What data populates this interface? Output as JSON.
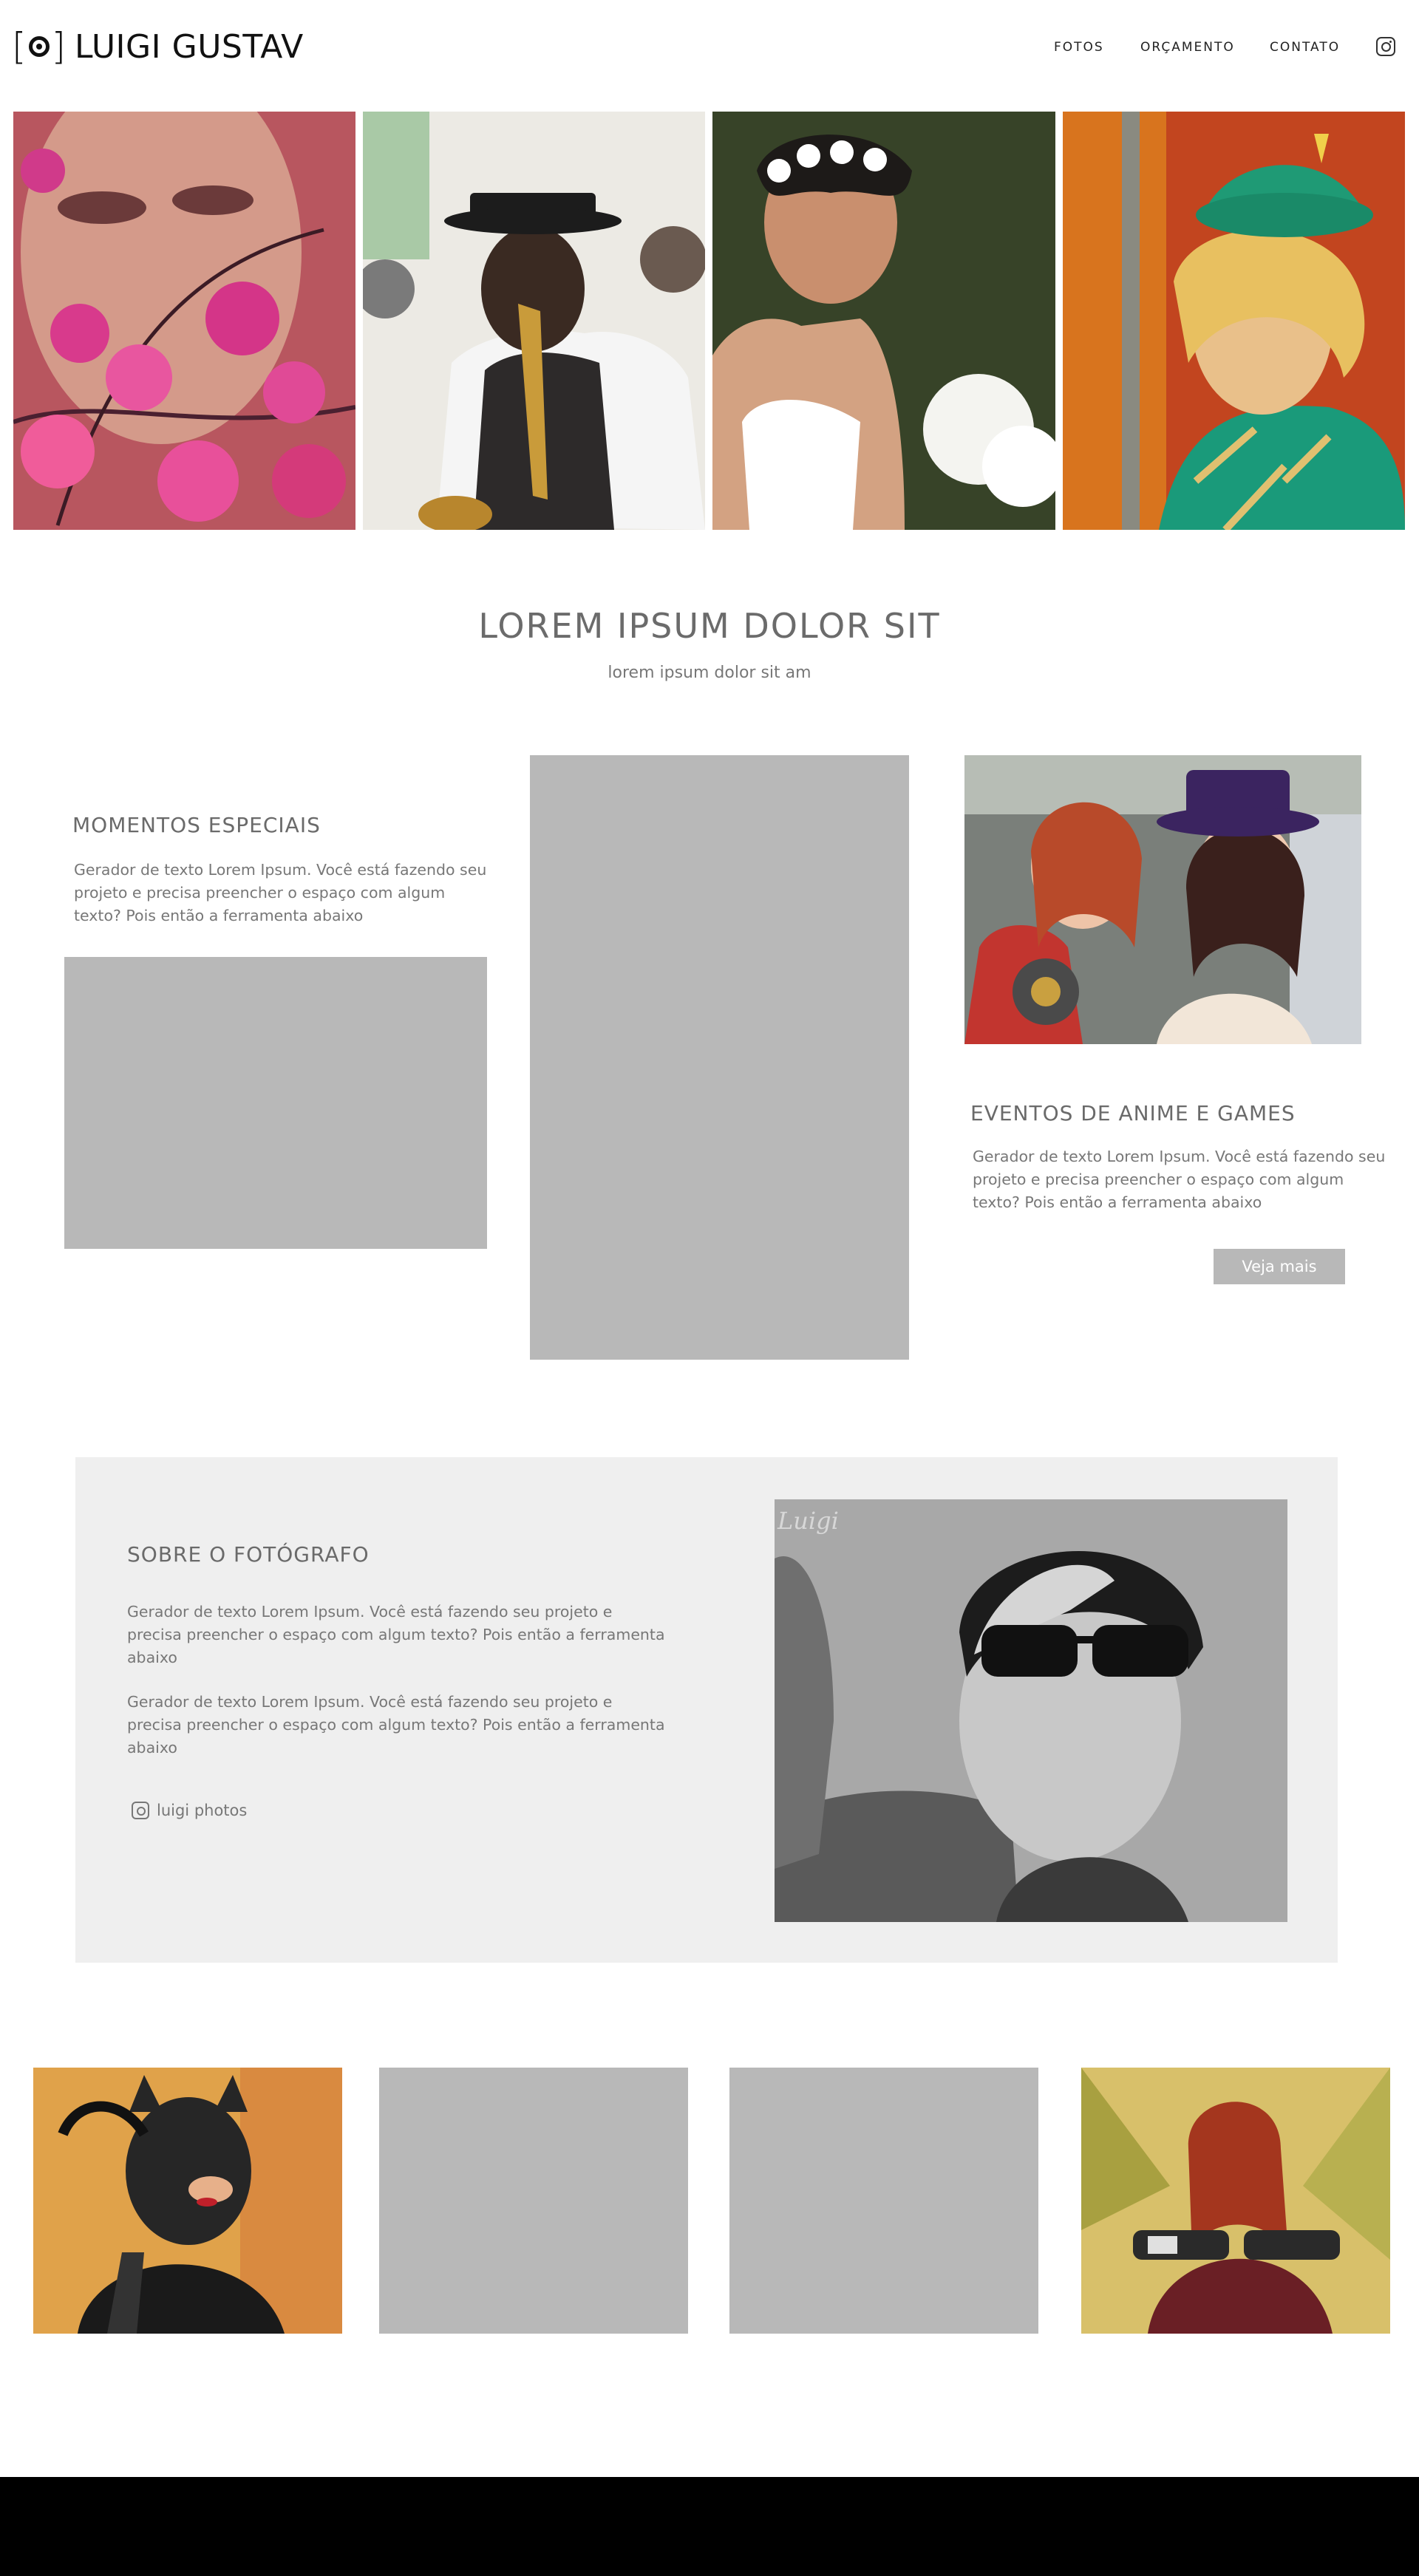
{
  "header": {
    "brand": "LUIGI GUSTAV",
    "nav": [
      "FOTOS",
      "ORÇAMENTO",
      "CONTATO"
    ],
    "social_icon": "instagram-icon"
  },
  "hero": {
    "title": "LOREM IPSUM DOLOR SIT",
    "subtitle": "lorem ipsum dolor sit am"
  },
  "sections": {
    "momentos": {
      "title": "MOMENTOS ESPECIAIS",
      "text": "Gerador de texto Lorem Ipsum. Você está fazendo seu projeto e precisa preencher o espaço com algum texto? Pois então a ferramenta abaixo"
    },
    "eventos": {
      "title": "EVENTOS DE ANIME E GAMES",
      "text": "Gerador de texto Lorem Ipsum. Você está fazendo seu projeto e precisa preencher o espaço com algum texto? Pois então a ferramenta abaixo",
      "button": "Veja mais"
    }
  },
  "about": {
    "title": "SOBRE O FOTÓGRAFO",
    "paragraph1": "Gerador de texto Lorem Ipsum. Você está fazendo seu projeto e precisa preencher o espaço com algum texto? Pois então a ferramenta abaixo",
    "paragraph2": "Gerador de texto Lorem Ipsum. Você está fazendo seu projeto e precisa preencher o espaço com algum texto? Pois então a ferramenta abaixo",
    "social_label": "luigi photos",
    "watermark": "Luigi"
  },
  "colors": {
    "placeholder": "#b8b8b8",
    "about_background": "#efefef",
    "footer": "#000000",
    "text": "#6b6b6b"
  }
}
